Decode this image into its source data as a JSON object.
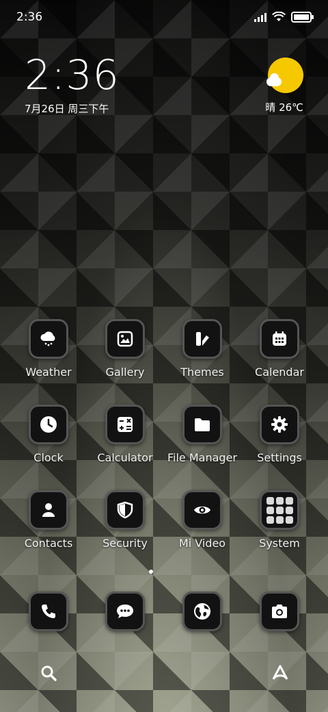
{
  "status_bar": {
    "time": "2:36"
  },
  "clock_widget": {
    "time": "2:36",
    "date": "7月26日 周三下午"
  },
  "weather_widget": {
    "text": "晴 26℃",
    "sun_color": "#f6c800"
  },
  "apps": [
    {
      "label": "Weather",
      "icon": "weather-icon"
    },
    {
      "label": "Gallery",
      "icon": "gallery-icon"
    },
    {
      "label": "Themes",
      "icon": "themes-icon"
    },
    {
      "label": "Calendar",
      "icon": "calendar-icon"
    },
    {
      "label": "Clock",
      "icon": "clock-icon"
    },
    {
      "label": "Calculator",
      "icon": "calculator-icon"
    },
    {
      "label": "File Manager",
      "icon": "folder-icon"
    },
    {
      "label": "Settings",
      "icon": "gear-icon"
    },
    {
      "label": "Contacts",
      "icon": "contacts-icon"
    },
    {
      "label": "Security",
      "icon": "shield-icon"
    },
    {
      "label": "Mi Video",
      "icon": "eye-icon"
    },
    {
      "label": "System",
      "icon": "system-folder-icon"
    }
  ],
  "dock": [
    {
      "icon": "phone-icon"
    },
    {
      "icon": "messages-icon"
    },
    {
      "icon": "browser-icon"
    },
    {
      "icon": "camera-icon"
    }
  ],
  "bottom_bar": {
    "left_icon": "search-icon",
    "right_icon": "app-vault-icon"
  }
}
